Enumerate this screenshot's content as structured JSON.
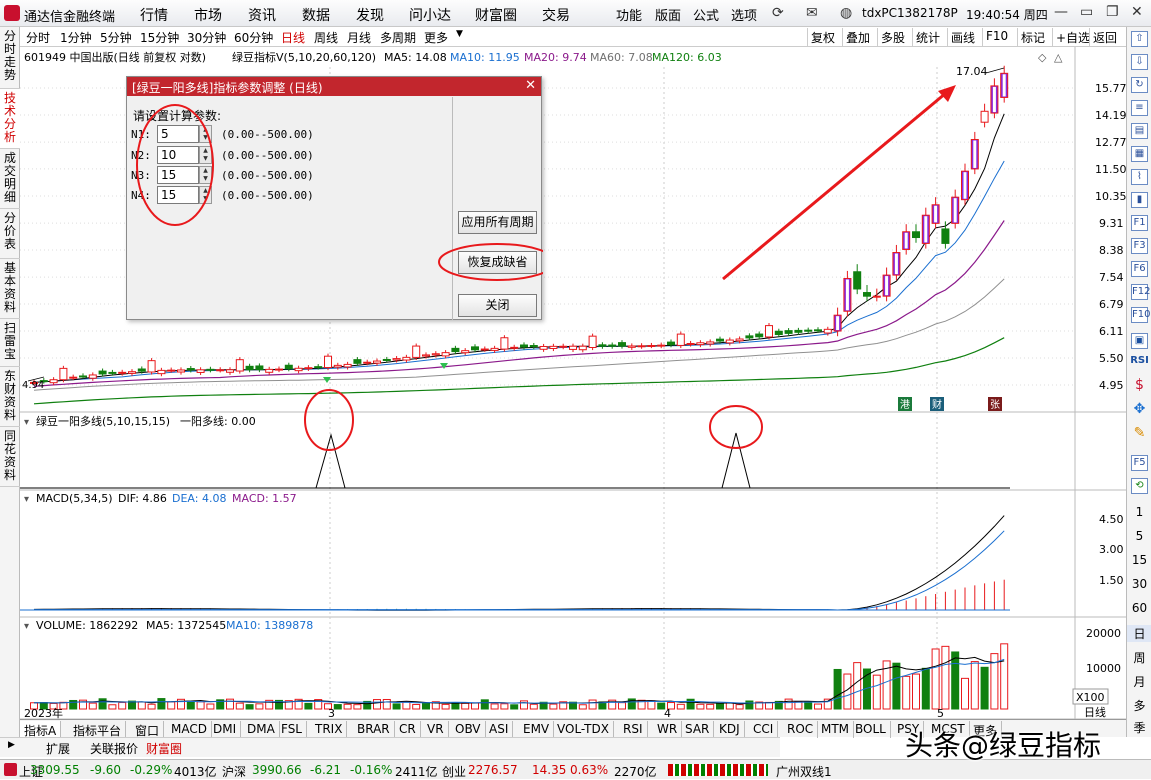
{
  "titlebar": {
    "app_title": "通达信金融终端",
    "menu": [
      "行情",
      "市场",
      "资讯",
      "数据",
      "发现",
      "问小达",
      "财富圈",
      "交易"
    ],
    "right_menu": [
      "功能",
      "版面",
      "公式",
      "选项"
    ],
    "account_id": "tdxPC1382178P",
    "clock": "19:40:54 周四",
    "icons": [
      "refresh-icon",
      "envelope-icon",
      "user-icon"
    ]
  },
  "left_tabs": [
    {
      "label": "分时走势",
      "active": false
    },
    {
      "label": "技术分析",
      "active": true
    },
    {
      "label": "成交明细",
      "active": false
    },
    {
      "label": "分价表",
      "active": false
    },
    {
      "label": "基本资料",
      "active": false
    },
    {
      "label": "扫雷宝",
      "active": false
    },
    {
      "label": "东财资料",
      "active": false
    },
    {
      "label": "同花资料",
      "active": false
    }
  ],
  "periods": [
    {
      "label": "分时",
      "active": false
    },
    {
      "label": "1分钟",
      "active": false
    },
    {
      "label": "5分钟",
      "active": false
    },
    {
      "label": "15分钟",
      "active": false
    },
    {
      "label": "30分钟",
      "active": false
    },
    {
      "label": "60分钟",
      "active": false
    },
    {
      "label": "日线",
      "active": true
    },
    {
      "label": "周线",
      "active": false
    },
    {
      "label": "月线",
      "active": false
    },
    {
      "label": "多周期",
      "active": false
    },
    {
      "label": "更多",
      "active": false
    }
  ],
  "toolbar_right": [
    "复权",
    "叠加",
    "多股",
    "统计",
    "画线",
    "F10",
    "标记",
    "+自选",
    "返回"
  ],
  "main_info": {
    "stock": "601949 中国出版(日线 前复权 对数)",
    "indicator": "绿豆指标V(5,10,20,60,120)",
    "ma5": "MA5: 14.08",
    "ma10": "MA10: 11.95",
    "ma20": "MA20: 9.74",
    "ma60": "MA60: 7.08",
    "ma120": "MA120: 6.03",
    "ma_colors": {
      "ma5": "#000000",
      "ma10": "#1a6fd0",
      "ma20": "#8b1a8b",
      "ma60": "#707070",
      "ma120": "#108010"
    }
  },
  "main_axis": [
    "15.77",
    "14.19",
    "12.77",
    "11.50",
    "10.35",
    "9.31",
    "8.38",
    "7.54",
    "6.79",
    "6.11",
    "5.50",
    "4.95"
  ],
  "high_label": "17.04",
  "low_label": "4.94",
  "event_badges": [
    {
      "text": "港",
      "color": "#1b7a3b"
    },
    {
      "text": "财",
      "color": "#1b5e7a"
    },
    {
      "text": "张",
      "color": "#7a1b1b"
    }
  ],
  "sub1": {
    "title": "绿豆一阳多线(5,10,15,15)",
    "value": "一阳多线: 0.00"
  },
  "macd": {
    "title": "MACD(5,34,5)",
    "dif": "DIF: 4.86",
    "dea": "DEA: 4.08",
    "macd": "MACD: 1.57",
    "axis": [
      "4.50",
      "3.00",
      "1.50"
    ]
  },
  "volume": {
    "title": "VOLUME: 1862292",
    "ma5": "MA5: 1372545",
    "ma10": "MA10: 1389878",
    "axis": [
      "20000",
      "10000"
    ],
    "unit": "X100"
  },
  "time_labels": [
    "2023年",
    "3",
    "4",
    "5",
    "日线"
  ],
  "dialog": {
    "title": "[绿豆一阳多线]指标参数调整 (日线)",
    "prompt": "请设置计算参数:",
    "params": [
      {
        "label": "N1:",
        "value": "5",
        "range": "(0.00--500.00)"
      },
      {
        "label": "N2:",
        "value": "10",
        "range": "(0.00--500.00)"
      },
      {
        "label": "N3:",
        "value": "15",
        "range": "(0.00--500.00)"
      },
      {
        "label": "N4:",
        "value": "15",
        "range": "(0.00--500.00)"
      }
    ],
    "apply_all": "应用所有周期",
    "restore_default": "恢复成缺省",
    "close": "关闭"
  },
  "indicator_tabs": [
    "指标A",
    "指标平台",
    "窗口",
    "MACD",
    "DMI",
    "DMA",
    "FSL",
    "TRIX",
    "BRAR",
    "CR",
    "VR",
    "OBV",
    "ASI",
    "EMV",
    "VOL-TDX",
    "RSI",
    "WR",
    "SAR",
    "KDJ",
    "CCI",
    "ROC",
    "MTM",
    "BOLL",
    "PSY",
    "MCST",
    "更多"
  ],
  "sub_tabs": [
    "扩展",
    "关联报价",
    "财富圈"
  ],
  "right_icons": [
    "up-arrow-icon",
    "down-arrow-icon",
    "blue-arrow-icon",
    "list-icon",
    "bars-icon",
    "grid-icon",
    "chart-icon",
    "candles-icon",
    "f1-icon",
    "f3-icon",
    "f6-icon",
    "f12-icon",
    "f10-icon",
    "rsi-label",
    "dollar-icon",
    "move-icon",
    "pencil-icon",
    "f5-icon",
    "square-icon"
  ],
  "right_periods": [
    "1",
    "5",
    "15",
    "30",
    "60",
    "日",
    "周",
    "月",
    "多",
    "季"
  ],
  "right_rsi": "RSI",
  "status": {
    "sh_label": "上证",
    "sh_value": "3309.55",
    "sh_change": "-9.60",
    "sh_pct": "-0.29%",
    "sh_amount": "4013亿",
    "hs_label": "沪深",
    "hs_value": "3990.66",
    "hs_change": "-6.21",
    "hs_pct": "-0.16%",
    "hs_amount": "2411亿",
    "cy_label": "创业",
    "cy_value": "2276.57",
    "cy_change": "14.35",
    "cy_pct": "0.63%",
    "cy_amount": "2270亿",
    "extra": "广州双线1"
  },
  "watermark": "头条@绿豆指标",
  "chart_data": {
    "type": "candlestick",
    "title": "601949 中国出版(日线 前复权 对数)",
    "main_axis_ticks": [
      15.77,
      14.19,
      12.77,
      11.5,
      10.35,
      9.31,
      8.38,
      7.54,
      6.79,
      6.11,
      5.5,
      4.95
    ],
    "candles_after_breakout": [
      {
        "o": 6.11,
        "c": 6.5
      },
      {
        "o": 6.6,
        "c": 7.5
      },
      {
        "o": 7.7,
        "c": 7.2
      },
      {
        "o": 7.1,
        "c": 7.0
      },
      {
        "o": 7.0,
        "c": 7.0
      },
      {
        "o": 7.0,
        "c": 7.6
      },
      {
        "o": 7.6,
        "c": 8.3
      },
      {
        "o": 8.4,
        "c": 9.0
      },
      {
        "o": 9.0,
        "c": 8.8
      },
      {
        "o": 8.6,
        "c": 9.6
      },
      {
        "o": 9.3,
        "c": 10.0
      },
      {
        "o": 9.1,
        "c": 8.6
      },
      {
        "o": 9.3,
        "c": 10.3
      },
      {
        "o": 10.2,
        "c": 11.4
      },
      {
        "o": 11.5,
        "c": 12.9
      },
      {
        "o": 13.8,
        "c": 14.4
      },
      {
        "o": 14.3,
        "c": 15.9
      },
      {
        "o": 15.2,
        "c": 16.7
      }
    ],
    "high": 17.04,
    "low": 4.94,
    "signal_peaks": 2,
    "macd": {
      "dif": 4.86,
      "dea": 4.08,
      "macd": 1.57,
      "axis": [
        4.5,
        3.0,
        1.5
      ]
    },
    "volume": {
      "last": 1862292,
      "ma5": 1372545,
      "ma10": 1389878,
      "axis": [
        20000,
        10000
      ]
    }
  }
}
